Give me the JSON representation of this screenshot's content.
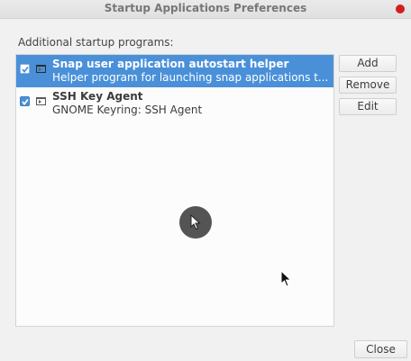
{
  "window": {
    "title": "Startup Applications Preferences"
  },
  "section_label": "Additional startup programs:",
  "programs": [
    {
      "name": "Snap user application autostart helper",
      "description": "Helper program for launching snap applications t...",
      "enabled": true,
      "selected": true
    },
    {
      "name": "SSH Key Agent",
      "description": "GNOME Keyring: SSH Agent",
      "enabled": true,
      "selected": false
    }
  ],
  "buttons": {
    "add": "Add",
    "remove": "Remove",
    "edit": "Edit",
    "close": "Close"
  },
  "colors": {
    "selection": "#4a90d9",
    "close_dot": "#d21f1f"
  }
}
